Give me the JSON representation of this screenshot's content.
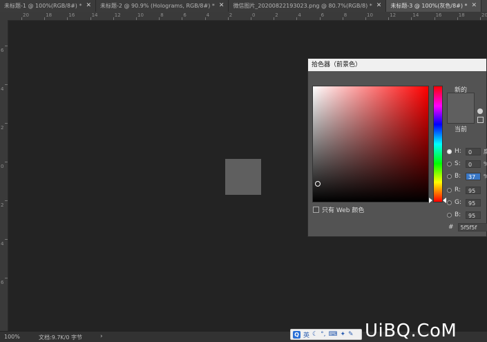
{
  "tabs": [
    {
      "label": "未标题-1 @ 100%(RGB/8#) *",
      "close": "✕"
    },
    {
      "label": "未标题-2 @ 90.9% (Holograms, RGB/8#) *",
      "close": "✕"
    },
    {
      "label": "微信图片_20200822193023.png @ 80.7%(RGB/8) *",
      "close": "✕"
    },
    {
      "label": "未标题-3 @ 100%(灰色/8#) *",
      "close": "✕",
      "active": true
    }
  ],
  "ruler_top": [
    "20",
    "18",
    "16",
    "14",
    "12",
    "10",
    "8",
    "6",
    "4",
    "2",
    "0",
    "2",
    "4",
    "6",
    "8",
    "10",
    "12",
    "14",
    "16",
    "18",
    "20"
  ],
  "ruler_left": [
    "6",
    "4",
    "2",
    "0",
    "2",
    "4",
    "6"
  ],
  "status": {
    "zoom": "100%",
    "doc": "文档:9.7K/0 字节",
    "arrow": "›"
  },
  "ime": {
    "logo": "Q",
    "lang": "英",
    "items": [
      "☾",
      "°,",
      "⌨",
      "✦",
      "✎"
    ]
  },
  "watermark": "UiBQ.CoM",
  "picker": {
    "title": "拾色器（前景色）",
    "new_label": "新的",
    "current_label": "当前",
    "new_color": "#5f5f5f",
    "current_color": "#5f5f5f",
    "web_only": "只有 Web 颜色",
    "h_label": "H:",
    "h_value": "0",
    "h_unit": "度",
    "s_label": "S:",
    "s_value": "0",
    "s_unit": "%",
    "b_label": "B:",
    "b_value": "37",
    "b_unit": "%",
    "r_label": "R:",
    "r_value": "95",
    "g_label": "G:",
    "g_value": "95",
    "bl_label": "B:",
    "bl_value": "95",
    "hash": "#",
    "hex_value": "5f5f5f"
  }
}
